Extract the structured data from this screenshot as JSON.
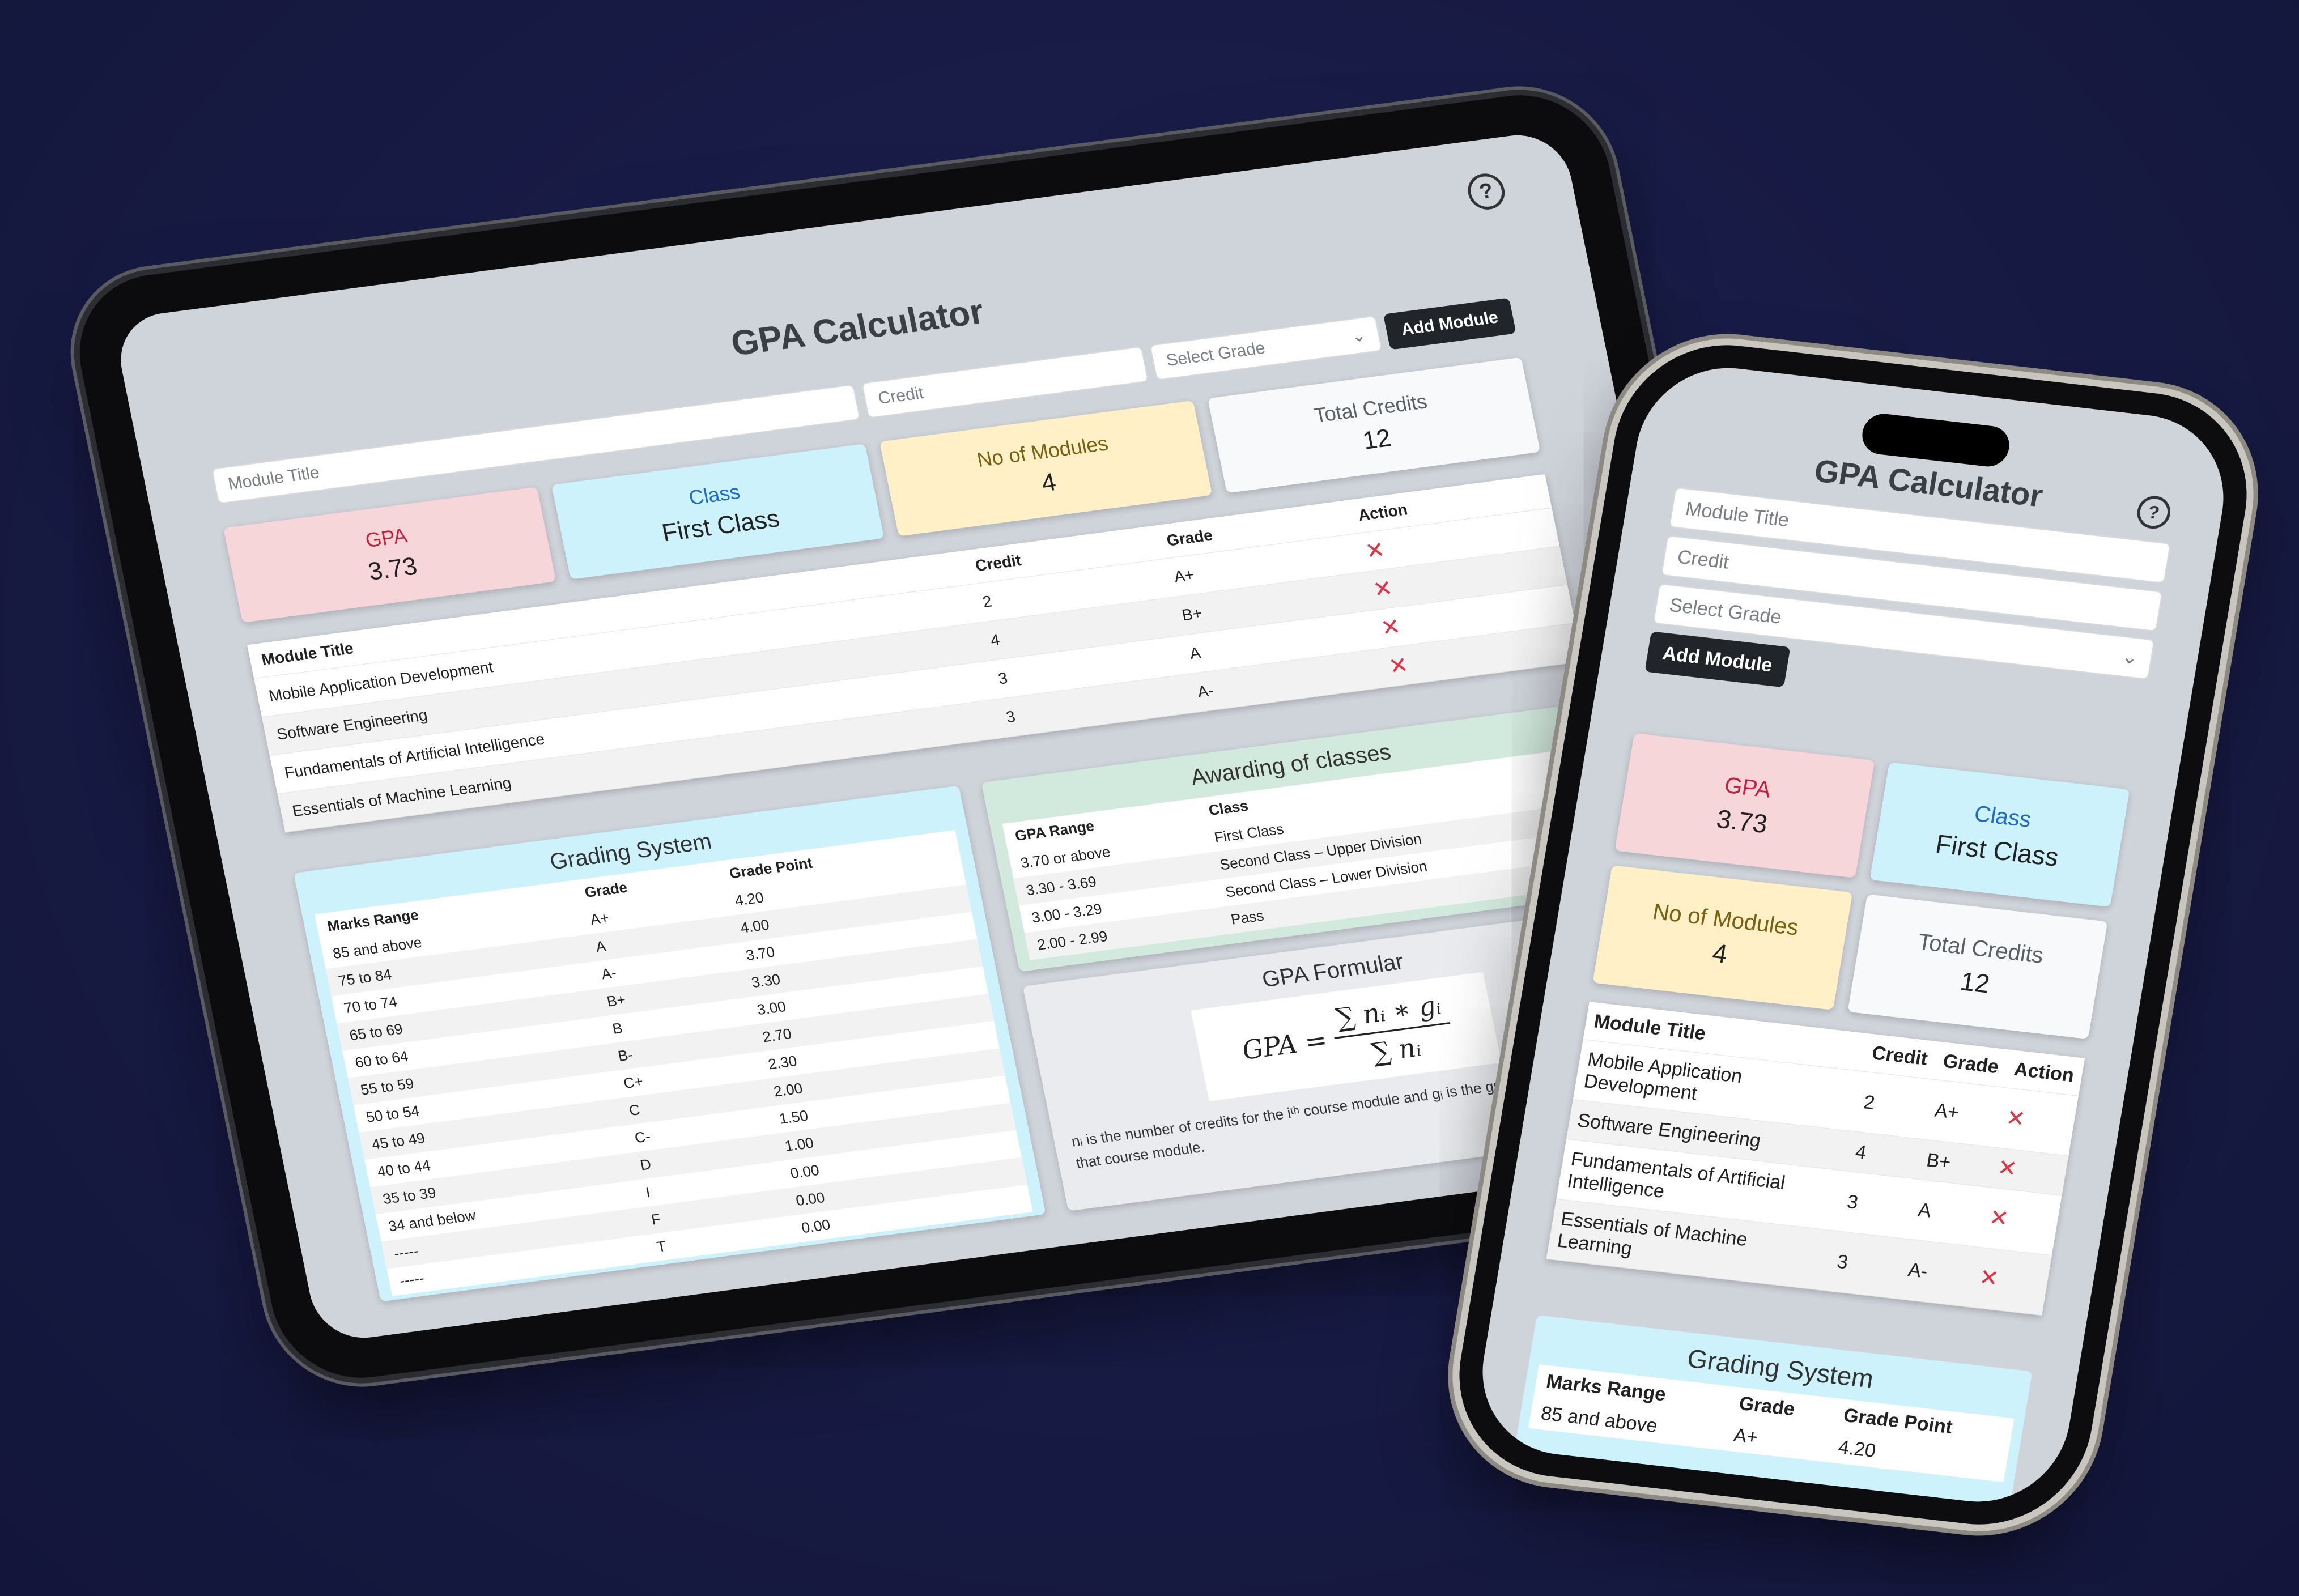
{
  "app": {
    "title": "GPA Calculator",
    "help_icon": "?"
  },
  "form": {
    "module_title_placeholder": "Module Title",
    "credit_placeholder": "Credit",
    "grade_select": "Select Grade",
    "add_button": "Add Module"
  },
  "stats": {
    "gpa_label": "GPA",
    "gpa_value": "3.73",
    "class_label": "Class",
    "class_value": "First Class",
    "modules_label": "No of Modules",
    "modules_value": "4",
    "credits_label": "Total Credits",
    "credits_value": "12"
  },
  "modules": {
    "headers": [
      "Module Title",
      "Credit",
      "Grade",
      "Action"
    ],
    "rows": [
      {
        "title": "Mobile Application Development",
        "credit": "2",
        "grade": "A+"
      },
      {
        "title": "Software Engineering",
        "credit": "4",
        "grade": "B+"
      },
      {
        "title": "Fundamentals of Artificial Intelligence",
        "credit": "3",
        "grade": "A"
      },
      {
        "title": "Essentials of Machine Learning",
        "credit": "3",
        "grade": "A-"
      }
    ],
    "delete_icon": "✕"
  },
  "grading": {
    "title": "Grading System",
    "headers": [
      "Marks Range",
      "Grade",
      "Grade Point"
    ],
    "rows": [
      [
        "85 and above",
        "A+",
        "4.20"
      ],
      [
        "75 to 84",
        "A",
        "4.00"
      ],
      [
        "70 to 74",
        "A-",
        "3.70"
      ],
      [
        "65 to 69",
        "B+",
        "3.30"
      ],
      [
        "60 to 64",
        "B",
        "3.00"
      ],
      [
        "55 to 59",
        "B-",
        "2.70"
      ],
      [
        "50 to 54",
        "C+",
        "2.30"
      ],
      [
        "45 to 49",
        "C",
        "2.00"
      ],
      [
        "40 to 44",
        "C-",
        "1.50"
      ],
      [
        "35 to 39",
        "D",
        "1.00"
      ],
      [
        "34 and below",
        "I",
        "0.00"
      ],
      [
        "-----",
        "F",
        "0.00"
      ],
      [
        "-----",
        "T",
        "0.00"
      ]
    ]
  },
  "awarding": {
    "title": "Awarding of classes",
    "headers": [
      "GPA Range",
      "Class"
    ],
    "rows": [
      [
        "3.70 or above",
        "First Class"
      ],
      [
        "3.30 - 3.69",
        "Second Class – Upper Division"
      ],
      [
        "3.00 - 3.29",
        "Second Class – Lower Division"
      ],
      [
        "2.00 - 2.99",
        "Pass"
      ]
    ]
  },
  "formula": {
    "title": "GPA Formular",
    "lhs": "GPA =",
    "numerator": "∑ nᵢ ∗ gᵢ",
    "denominator": "∑ nᵢ",
    "note": "nᵢ is the number of credits for the iᵗʰ course module and gᵢ is the grade point earned for that course module."
  }
}
